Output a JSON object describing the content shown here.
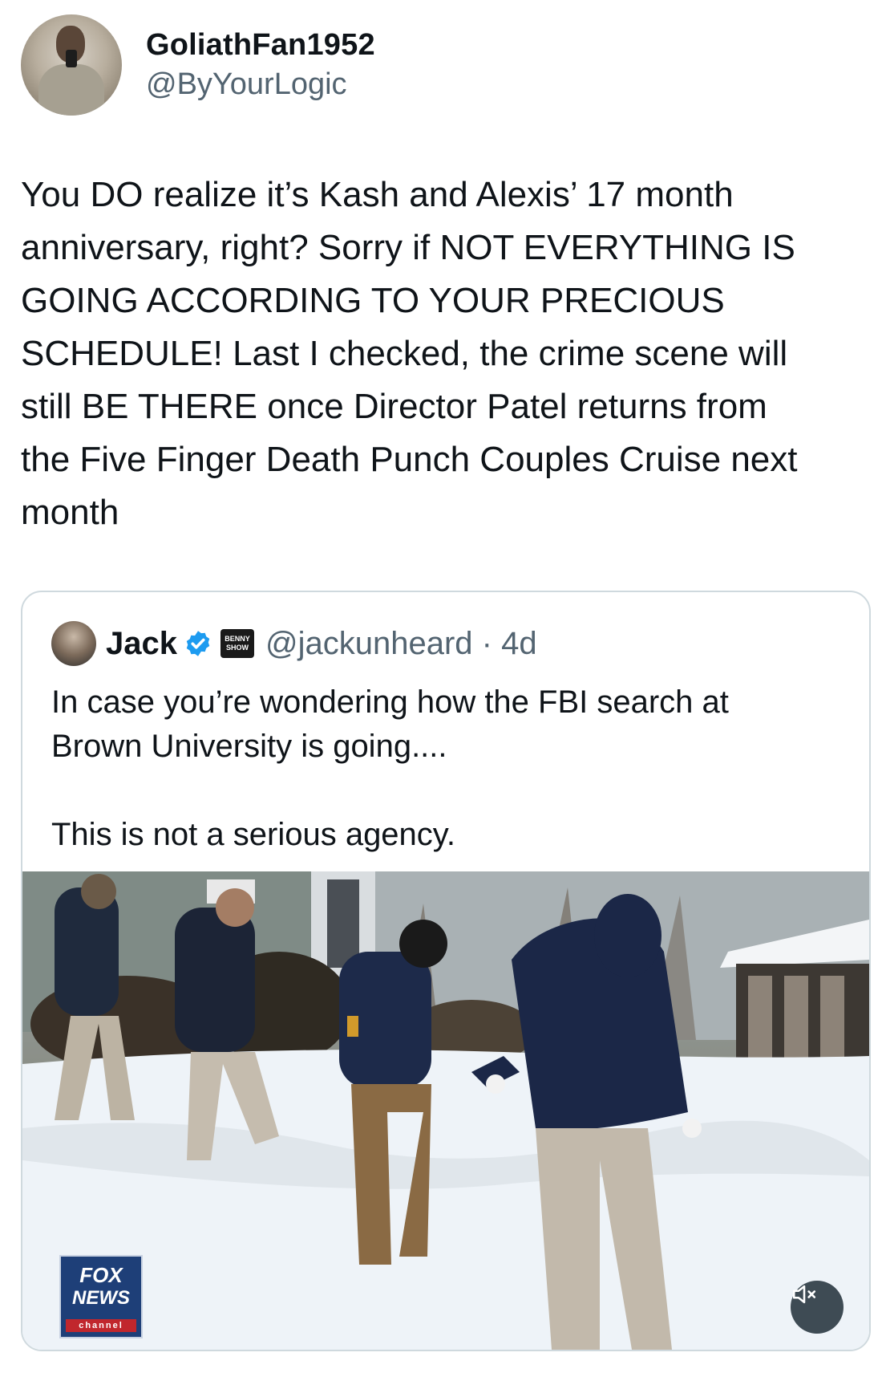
{
  "tweet": {
    "author": {
      "display_name": "GoliathFan1952",
      "handle": "@ByYourLogic"
    },
    "text": "You DO realize it’s Kash and Alexis’ 17 month\nanniversary, right? Sorry if NOT EVERYTHING IS\nGOING ACCORDING TO YOUR PRECIOUS\nSCHEDULE! Last I checked, the crime scene will\nstill BE THERE once Director Patel returns from\nthe Five Finger Death Punch Couples Cruise next\nmonth"
  },
  "quoted_tweet": {
    "author": {
      "display_name": "Jack",
      "verified": true,
      "affiliate_badge_text": "BENNY SHOW",
      "handle": "@jackunheard",
      "separator": "·",
      "age": "4d"
    },
    "text": "In case you’re wondering how the FBI search at\nBrown University is going....\n\nThis is not a serious agency.",
    "media": {
      "channel_logo": {
        "line1": "FOX",
        "line2": "NEWS",
        "line3": "channel"
      },
      "mute_icon": "speaker-muted-icon"
    }
  },
  "colors": {
    "text_primary": "#0f1419",
    "text_secondary": "#536471",
    "verified_blue": "#1d9bf0",
    "card_border": "#cfd9de"
  }
}
